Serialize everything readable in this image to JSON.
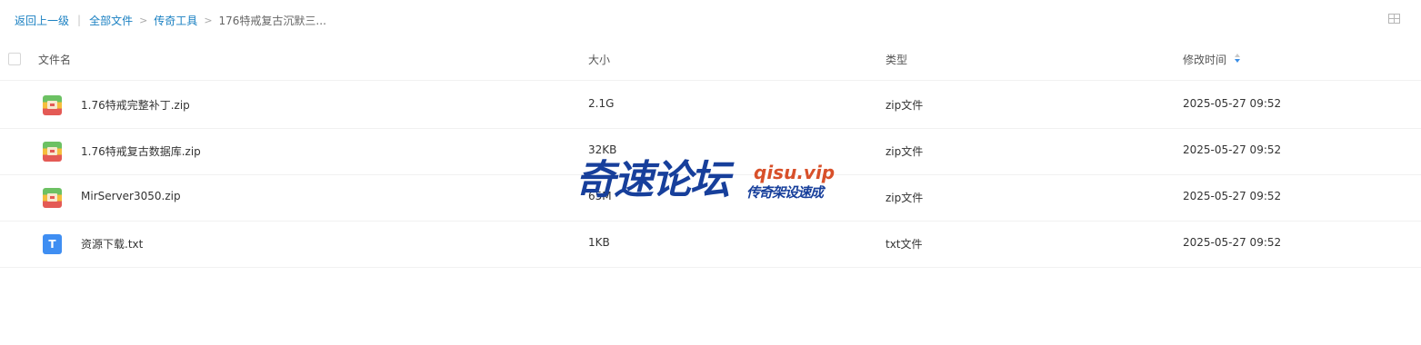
{
  "breadcrumb": {
    "back": "返回上一级",
    "separator": "|",
    "all_files": "全部文件",
    "folder": "传奇工具",
    "current": "176特戒复古沉默三..."
  },
  "toolbar": {
    "view_toggle_icon": "grid-view-icon"
  },
  "columns": {
    "name": "文件名",
    "size": "大小",
    "type": "类型",
    "modified": "修改时间"
  },
  "sort": {
    "column": "修改时间",
    "direction": "descending"
  },
  "files": [
    {
      "icon": "zip-file-icon",
      "name": "1.76特戒完整补丁.zip",
      "size": "2.1G",
      "type": "zip文件",
      "modified": "2025-05-27 09:52"
    },
    {
      "icon": "zip-file-icon",
      "name": "1.76特戒复古数据库.zip",
      "size": "32KB",
      "type": "zip文件",
      "modified": "2025-05-27 09:52"
    },
    {
      "icon": "zip-file-icon",
      "name": "MirServer3050.zip",
      "size": "65M",
      "type": "zip文件",
      "modified": "2025-05-27 09:52"
    },
    {
      "icon": "txt-file-icon",
      "name": "资源下载.txt",
      "size": "1KB",
      "type": "txt文件",
      "modified": "2025-05-27 09:52"
    }
  ],
  "watermark": {
    "title": "奇速论坛",
    "url": "qisu.vip",
    "tagline": "传奇架设速成"
  },
  "colors": {
    "link": "#1a80c2",
    "row_divider": "#f1f1f1",
    "watermark_blue": "#173f9b",
    "watermark_orange": "#d8502a"
  }
}
